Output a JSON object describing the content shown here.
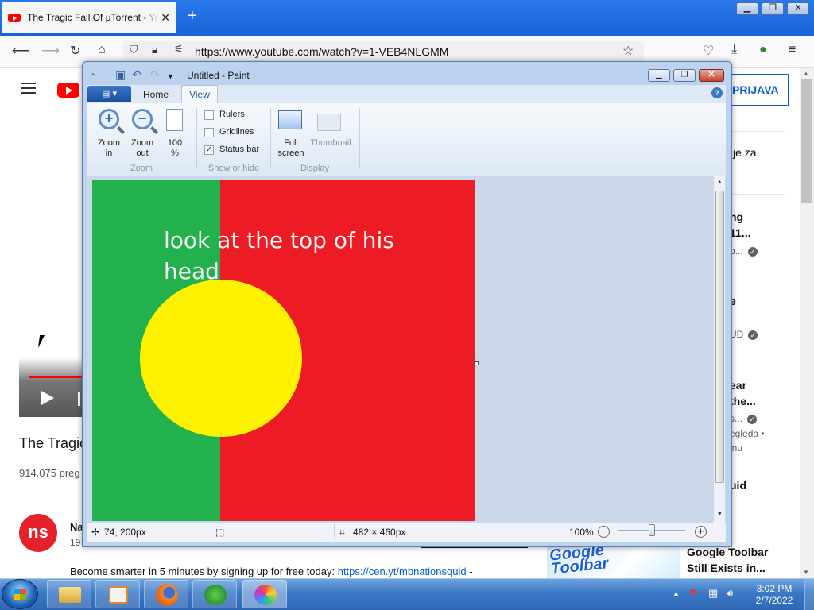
{
  "browser": {
    "tab_title": "The Tragic Fall Of µTorrent - YouTube",
    "tab_close": "✕",
    "new_tab": "+",
    "url": "https://www.youtube.com/watch?v=1-VEB4NLGMM",
    "window_controls": {
      "minimize": "▁",
      "restore": "❐",
      "close": "✕"
    }
  },
  "youtube": {
    "sign_in": "PRIJAVA",
    "video_title": "The Tragic",
    "views": "914.075 preg",
    "channel_name": "Na",
    "channel_subs": "19",
    "channel_initials": "ns",
    "description_text": "Become smarter in 5 minutes by signing up for free today: ",
    "description_link": "https://cen.yt/mbnationsquid",
    "description_suffix": " -",
    "sidebar": {
      "card_text": "je za",
      "r1_title_a": "ng",
      "r1_title_b": "11...",
      "r1_sub": "p...",
      "r2_title": "e",
      "r2_sub": "UD",
      "r3_title_a": "ear",
      "r3_title_b": "the...",
      "r3_sub1": "s...",
      "r3_sub2": "egleda •",
      "r3_sub3": "inu",
      "r4_title": "uid",
      "promo_logo_1": "Google",
      "promo_logo_2": "Toolbar",
      "promo_title_1": "Google Toolbar",
      "promo_title_2": "Still Exists in..."
    }
  },
  "paint": {
    "title": "Untitled - Paint",
    "tabs": {
      "file": "▤ ▾",
      "home": "Home",
      "view": "View"
    },
    "help": "?",
    "zoom_group": {
      "label": "Zoom",
      "zoom_in": [
        "Zoom",
        "in"
      ],
      "zoom_out": [
        "Zoom",
        "out"
      ],
      "hundred": [
        "100",
        "%"
      ]
    },
    "show_hide_group": {
      "label": "Show or hide",
      "rulers": "Rulers",
      "gridlines": "Gridlines",
      "status_bar": "Status bar",
      "rulers_checked": false,
      "gridlines_checked": false,
      "status_bar_checked": true,
      "check_glyph": "✓"
    },
    "display_group": {
      "label": "Display",
      "full_screen": [
        "Full",
        "screen"
      ],
      "thumbnail": "Thumbnail"
    },
    "canvas": {
      "text_line1": "look at the top of his",
      "text_line2": "head",
      "colors": {
        "green": "#22b14c",
        "red": "#ed1c24",
        "yellow": "#fff200"
      }
    },
    "status": {
      "cursor_pos": "74, 200px",
      "image_size": "482 × 460px",
      "zoom": "100%",
      "zoom_minus": "−",
      "zoom_plus": "+"
    }
  },
  "taskbar": {
    "time": "3:02 PM",
    "date": "2/7/2022"
  }
}
